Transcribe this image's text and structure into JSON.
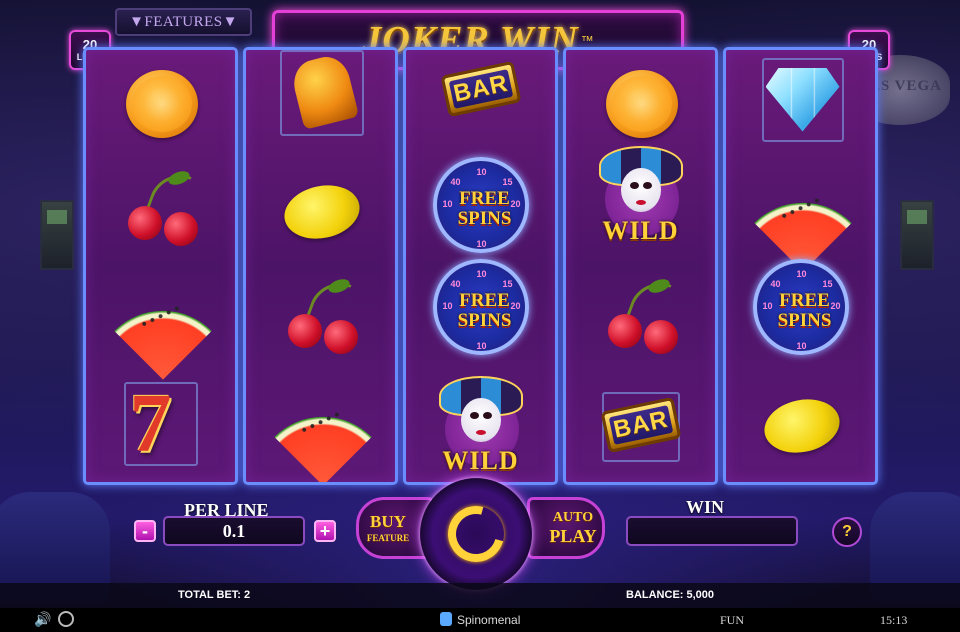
{
  "game": {
    "title": "JOKER WIN",
    "trademark": "™",
    "features_label": "▼FEATURES▼",
    "lines_left": {
      "number": "20",
      "label": "LINES"
    },
    "lines_right": {
      "number": "20",
      "label": "LINES"
    }
  },
  "reels": [
    [
      "orange",
      "cherry",
      "watermelon",
      "seven"
    ],
    [
      "bell",
      "lemon",
      "cherry",
      "watermelon"
    ],
    [
      "bar",
      "free-spins",
      "free-spins",
      "wild"
    ],
    [
      "orange",
      "wild",
      "cherry",
      "bar"
    ],
    [
      "diamond",
      "watermelon",
      "free-spins",
      "lemon"
    ]
  ],
  "symbols": {
    "bar_text": "BAR",
    "free_spins_text_1": "FREE",
    "free_spins_text_2": "SPINS",
    "wild_text": "WILD",
    "seven_text": "7"
  },
  "background": {
    "sign_text": "LAS VEGA"
  },
  "controls": {
    "per_line_label": "PER LINE",
    "per_line_value": "0.1",
    "minus_label": "-",
    "plus_label": "+",
    "buy_label": "BUY",
    "buy_sub_label": "FEATURE",
    "auto_label": "AUTO",
    "auto_sub_label": "PLAY",
    "win_label": "WIN",
    "win_value": "",
    "help_label": "?"
  },
  "info": {
    "total_bet": "TOTAL BET: 2",
    "balance": "BALANCE: 5,000"
  },
  "status": {
    "provider": "Spinomenal",
    "mode": "FUN",
    "time": "15:13"
  },
  "colors": {
    "accent_pink": "#e43fd6",
    "reel_border": "#6a8dff",
    "gold": "#f5c63a"
  }
}
